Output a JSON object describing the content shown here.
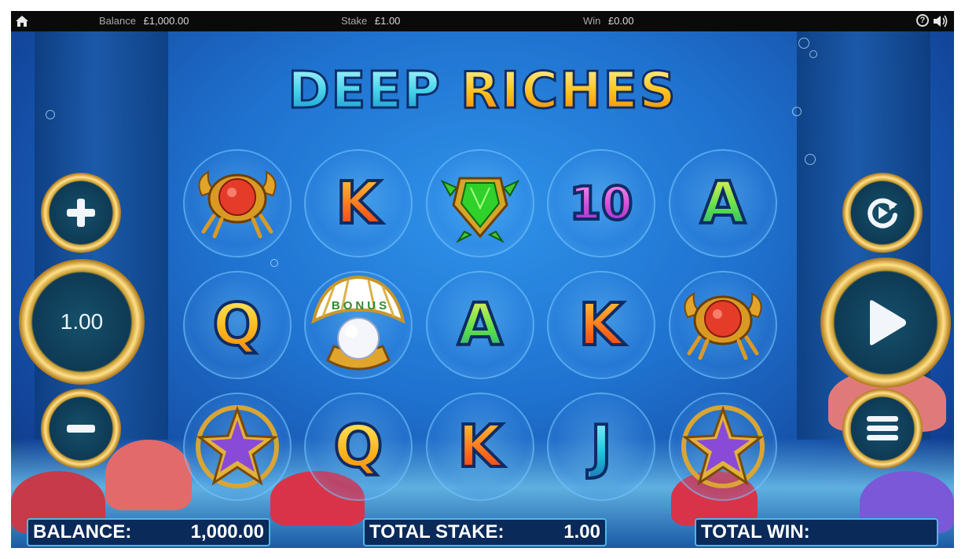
{
  "topbar": {
    "balance_label": "Balance",
    "balance_value": "£1,000.00",
    "stake_label": "Stake",
    "stake_value": "£1.00",
    "win_label": "Win",
    "win_value": "£0.00",
    "help_glyph": "?"
  },
  "logo": {
    "word1": "DEEP",
    "word2": "RICHES"
  },
  "reels": {
    "rows": [
      [
        "crab",
        "K",
        "turtle",
        "10",
        "A"
      ],
      [
        "Q",
        "bonus",
        "A",
        "K",
        "crab"
      ],
      [
        "starfish",
        "Q",
        "K",
        "J",
        "starfish"
      ]
    ],
    "bonus_text": "BONUS"
  },
  "controls": {
    "stake_display": "1.00",
    "increase_icon": "plus-icon",
    "decrease_icon": "minus-icon",
    "autoplay_icon": "autoplay-icon",
    "spin_icon": "play-icon",
    "menu_icon": "menu-icon"
  },
  "bottombar": {
    "balance_label": "BALANCE:",
    "balance_value": "1,000.00",
    "stake_label": "TOTAL STAKE:",
    "stake_value": "1.00",
    "win_label": "TOTAL WIN:",
    "win_value": ""
  },
  "colors": {
    "accent_gold": "#d9a933",
    "panel_border": "#4fb6e8",
    "panel_bg": "#0a2a5a"
  }
}
